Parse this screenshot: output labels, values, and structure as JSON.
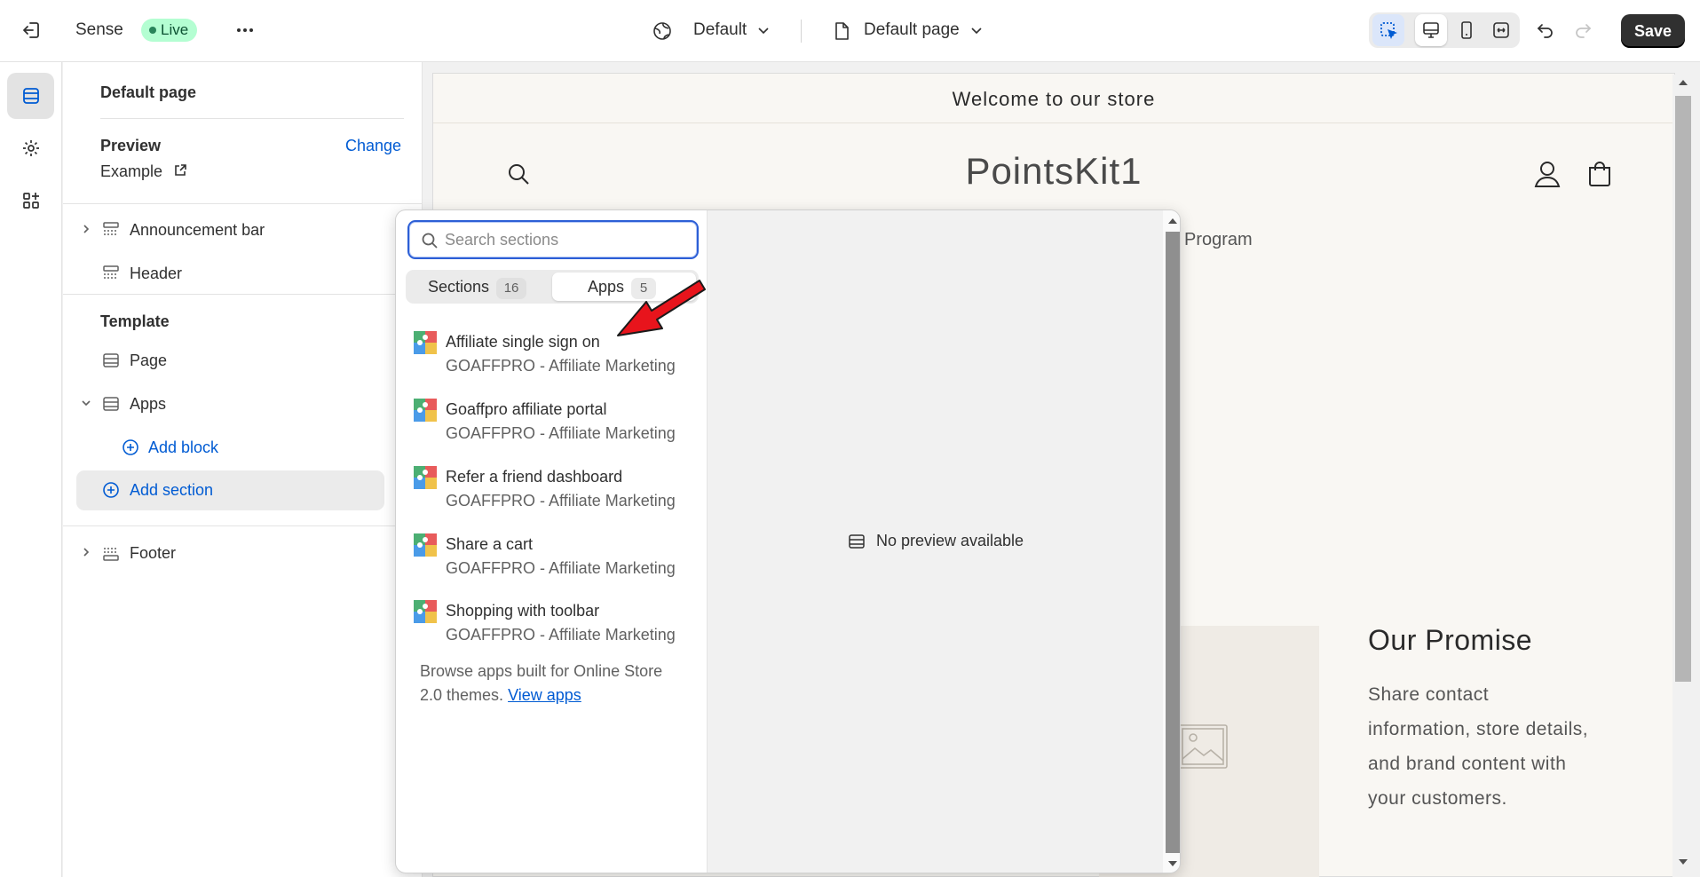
{
  "topbar": {
    "theme_name": "Sense",
    "live_label": "Live",
    "language_select": "Default",
    "page_select": "Default page",
    "save_label": "Save"
  },
  "sidebar": {
    "title": "Default page",
    "preview_label": "Preview",
    "change_link": "Change",
    "preview_value": "Example",
    "header_sections": [
      "Announcement bar",
      "Header"
    ],
    "template_label": "Template",
    "template_items": [
      "Page",
      "Apps"
    ],
    "add_block": "Add block",
    "add_section": "Add section",
    "footer": "Footer"
  },
  "preview": {
    "announcement": "Welcome to our store",
    "store_name": "PointsKit1",
    "nav_partial": "Program",
    "promise_title": "Our Promise",
    "promise_text_lines": [
      "Share contact",
      "information, store details,",
      "and brand content with",
      "your customers."
    ]
  },
  "popover": {
    "search_placeholder": "Search sections",
    "tabs": [
      {
        "label": "Sections",
        "count": "16"
      },
      {
        "label": "Apps",
        "count": "5"
      }
    ],
    "apps": [
      {
        "title": "Affiliate single sign on",
        "vendor": "GOAFFPRO - Affiliate Marketing"
      },
      {
        "title": "Goaffpro affiliate portal",
        "vendor": "GOAFFPRO - Affiliate Marketing"
      },
      {
        "title": "Refer a friend dashboard",
        "vendor": "GOAFFPRO - Affiliate Marketing"
      },
      {
        "title": "Share a cart",
        "vendor": "GOAFFPRO - Affiliate Marketing"
      },
      {
        "title": "Shopping with toolbar",
        "vendor": "GOAFFPRO - Affiliate Marketing"
      }
    ],
    "browse_text_1": "Browse apps built for Online Store",
    "browse_text_2": "2.0 themes.",
    "view_apps_link": "View apps",
    "no_preview": "No preview available"
  },
  "colors": {
    "accent_blue": "#005bd3",
    "live_bg": "#b4fed2",
    "save_bg": "#303030",
    "annotation_arrow": "#e8141c"
  },
  "icons": [
    "exit-icon",
    "more-icon",
    "globe-icon",
    "page-icon",
    "chevron-down-icon",
    "inspector-icon",
    "desktop-icon",
    "mobile-icon",
    "fullwidth-icon",
    "undo-icon",
    "redo-icon",
    "sections-icon",
    "settings-icon",
    "apps-icon",
    "search-icon",
    "account-icon",
    "cart-icon",
    "image-placeholder-icon"
  ]
}
